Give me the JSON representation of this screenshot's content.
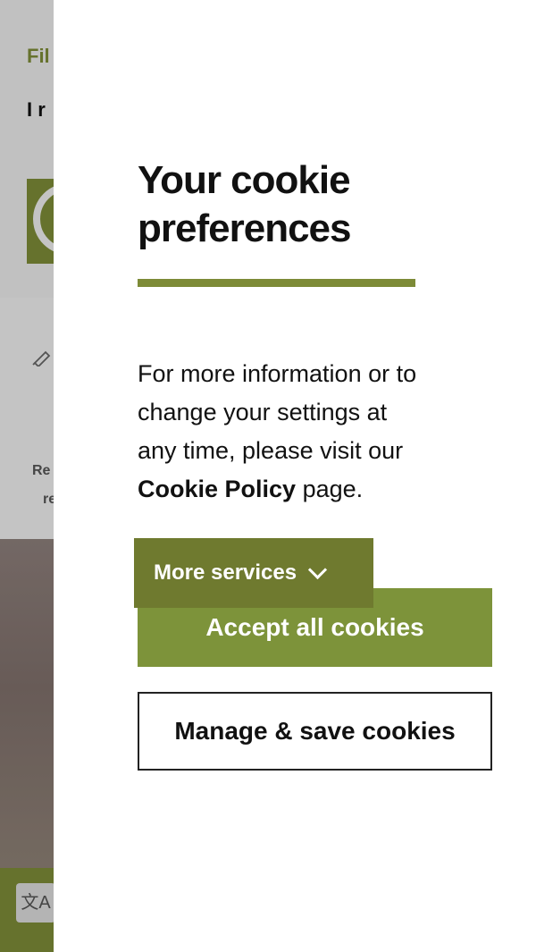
{
  "background": {
    "text_1": "Fil",
    "text_2": "I r",
    "small_text_1": "Re",
    "small_text_2": "re"
  },
  "cookie_panel": {
    "title": "Your cookie preferences",
    "info_prefix": "For more information or to change your settings at any time, please visit our ",
    "info_link": "Cookie Policy",
    "info_suffix": " page.",
    "more_services_label": "More services",
    "accept_label": "Accept all cookies",
    "manage_label": "Manage & save cookies"
  },
  "icons": {
    "chevron": "chevron-down-icon",
    "pen": "pen-icon",
    "translate": "translate-icon"
  },
  "colors": {
    "accent": "#7d8b37",
    "accept": "#7d933a",
    "more_services": "#6f7a2f"
  }
}
